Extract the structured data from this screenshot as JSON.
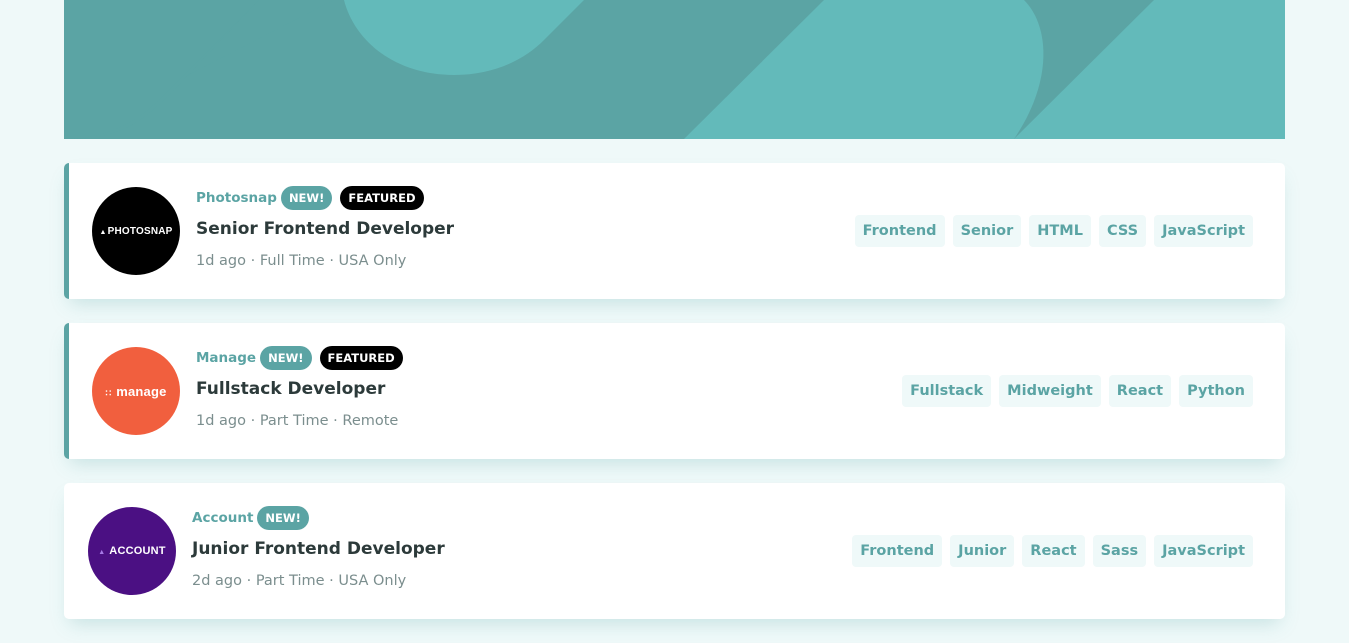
{
  "colors": {
    "accent": "#5ba4a4",
    "background": "#eff9f9",
    "heading": "#2c3a3a",
    "muted": "#7b8e8e",
    "featured_badge": "#000000"
  },
  "jobs": [
    {
      "company": "Photosnap",
      "logo_text": "PHOTOSNAP",
      "logo_color": "#000000",
      "new_label": "NEW!",
      "featured_label": "FEATURED",
      "position": "Senior Frontend Developer",
      "posted": "1d ago",
      "contract": "Full Time",
      "location": "USA Only",
      "tags": [
        "Frontend",
        "Senior",
        "HTML",
        "CSS",
        "JavaScript"
      ]
    },
    {
      "company": "Manage",
      "logo_text": "manage",
      "logo_color": "#f15f3e",
      "new_label": "NEW!",
      "featured_label": "FEATURED",
      "position": "Fullstack Developer",
      "posted": "1d ago",
      "contract": "Part Time",
      "location": "Remote",
      "tags": [
        "Fullstack",
        "Midweight",
        "React",
        "Python"
      ]
    },
    {
      "company": "Account",
      "logo_text": "ACCOUNT",
      "logo_color": "#4b1083",
      "new_label": "NEW!",
      "position": "Junior Frontend Developer",
      "posted": "2d ago",
      "contract": "Part Time",
      "location": "USA Only",
      "tags": [
        "Frontend",
        "Junior",
        "React",
        "Sass",
        "JavaScript"
      ]
    }
  ]
}
